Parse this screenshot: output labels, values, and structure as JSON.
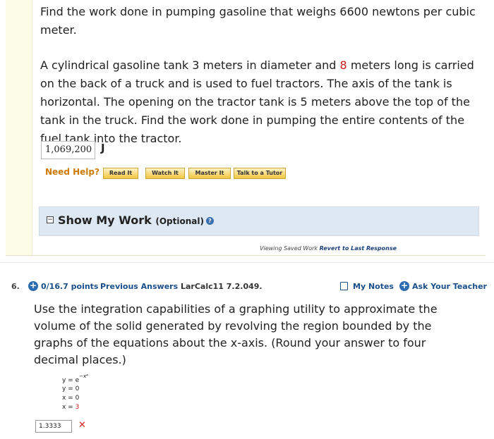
{
  "q5": {
    "intro": "Find the work done in pumping gasoline that weighs 6600 newtons per cubic meter.",
    "problem_a": "A cylindrical gasoline tank 3 meters in diameter and ",
    "problem_highlight": "8",
    "problem_b": " meters long is carried on the back of a truck and is used to fuel tractors. The axis of the tank is horizontal. The opening on the tractor tank is 5 meters above the top of the tank in the truck. Find the work done in pumping the entire contents of the fuel tank into the tractor.",
    "answer_value": "1,069,200",
    "answer_unit": "J",
    "need_help_label": "Need Help?",
    "help_buttons": [
      "Read It",
      "Watch It",
      "Master It",
      "Talk to a Tutor"
    ],
    "show_work_title": "Show My Work",
    "show_work_optional": "(Optional)",
    "viewing_text": "Viewing Saved Work",
    "revert_link": "Revert to Last Response"
  },
  "q6": {
    "number": "6.",
    "points": "0/16.7 points",
    "previous_answers": "Previous Answers",
    "reference": "LarCalc11 7.2.049.",
    "my_notes": "My Notes",
    "ask_teacher": "Ask Your Teacher",
    "question": "Use the integration capabilities of a graphing utility to approximate the volume of the solid generated by revolving the region bounded by the graphs of the equations about the x-axis. (Round your answer to four decimal places.)",
    "equations": {
      "eq1_lhs": "y = e",
      "eq1_exp": "−x⁴",
      "eq2": "y = 0",
      "eq3": "x = 0",
      "eq4_lhs": "x = ",
      "eq4_val": "3"
    },
    "answer_value": "1.3333",
    "status_icon": "x-mark-icon"
  },
  "colors": {
    "accent_blue": "#2b6cb0",
    "highlight_red": "#cc1a1a",
    "need_help_orange": "#cc7a00",
    "show_work_bg": "#dde8f3"
  }
}
